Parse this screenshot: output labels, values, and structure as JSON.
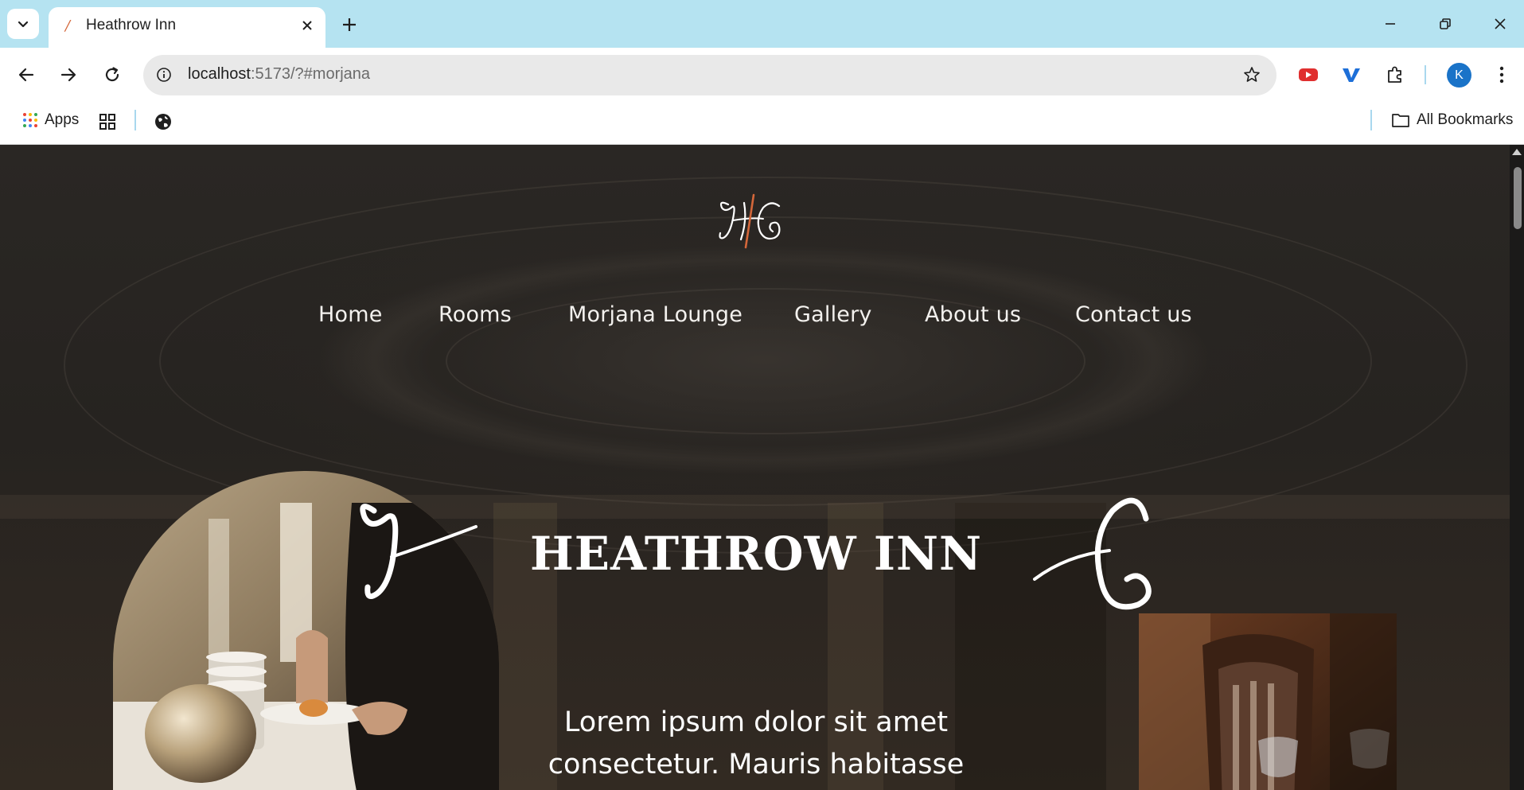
{
  "browser": {
    "tab": {
      "title": "Heathrow Inn",
      "favicon": "heathrow-favicon"
    },
    "url": {
      "host": "localhost",
      "path": ":5173/?#morjana"
    },
    "profile_initial": "K",
    "bookmarks": {
      "apps_label": "Apps",
      "all_bookmarks_label": "All Bookmarks"
    },
    "colors": {
      "tabbar": "#b5e3f1",
      "avatar": "#1a73c8"
    }
  },
  "site": {
    "nav": [
      {
        "label": "Home"
      },
      {
        "label": "Rooms"
      },
      {
        "label": "Morjana Lounge"
      },
      {
        "label": "Gallery"
      },
      {
        "label": "About us"
      },
      {
        "label": "Contact us"
      }
    ],
    "hero": {
      "title": "HEATHROW INN",
      "text": "Lorem ipsum dolor sit amet consectetur. Mauris habitasse"
    },
    "colors": {
      "accent": "#d4673a",
      "text": "#ffffff"
    }
  }
}
